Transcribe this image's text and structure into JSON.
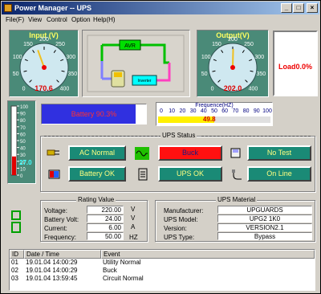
{
  "window": {
    "title": "Power Manager -- UPS"
  },
  "menu": [
    {
      "label": "File(F)"
    },
    {
      "label": "View"
    },
    {
      "label": "Control"
    },
    {
      "label": "Option"
    },
    {
      "label": "Help(H)"
    }
  ],
  "input_gauge": {
    "label": "Input (V)",
    "ticks": [
      "0",
      "50",
      "100",
      "150",
      "200",
      "250",
      "300",
      "350",
      "400"
    ],
    "value": "170.6",
    "reading": 170.6,
    "max": 400
  },
  "output_gauge": {
    "label": "Output(V)",
    "ticks": [
      "0",
      "50",
      "100",
      "150",
      "200",
      "250",
      "300",
      "350",
      "400"
    ],
    "value": "202.0",
    "reading": 202.0,
    "max": 400
  },
  "diagram": {
    "avr_label": "AVR",
    "inverter_label": "Inverter"
  },
  "load": {
    "text": "Load0.0%"
  },
  "thermometer": {
    "ticks": [
      "100",
      "90",
      "80",
      "70",
      "60",
      "50",
      "40",
      "30",
      "20",
      "10",
      "0"
    ],
    "value": "27.0",
    "level": 27
  },
  "battery": {
    "text": "Battery 90.3%",
    "level": 90.3
  },
  "frequency": {
    "label": "Frequence(HZ)",
    "ticks": [
      "0",
      "10",
      "20",
      "30",
      "40",
      "50",
      "60",
      "70",
      "80",
      "90",
      "100"
    ],
    "value": "49.8",
    "level": 49.8
  },
  "ups_status": {
    "title": "UPS Status",
    "ac_normal": "AC Normal",
    "buck": "Buck",
    "no_test": "No Test",
    "battery_ok": "Battery OK",
    "ups_ok": "UPS OK",
    "on_line": "On Line"
  },
  "rating": {
    "title": "Rating Value",
    "rows": [
      {
        "label": "Voltage:",
        "value": "220.00",
        "unit": "V"
      },
      {
        "label": "Battery Volt:",
        "value": "24.00",
        "unit": "V"
      },
      {
        "label": "Current:",
        "value": "6.00",
        "unit": "A"
      },
      {
        "label": "Frequency:",
        "value": "50.00",
        "unit": "HZ"
      }
    ]
  },
  "material": {
    "title": "UPS Material",
    "rows": [
      {
        "label": "Manufacturer:",
        "value": "UPGUARDS"
      },
      {
        "label": "UPS Model:",
        "value": "UPG2 1K0"
      },
      {
        "label": "Version:",
        "value": "VERSION2.1"
      },
      {
        "label": "UPS Type:",
        "value": "Bypass"
      }
    ]
  },
  "events": {
    "columns": [
      "ID",
      "Date / Time",
      "Event"
    ],
    "rows": [
      {
        "id": "01",
        "time": "19.01.04 14:00:29",
        "event": "Utility Normal"
      },
      {
        "id": "02",
        "time": "19.01.04 14:00:29",
        "event": "Buck"
      },
      {
        "id": "03",
        "time": "19.01.04 13:59:45",
        "event": "Circuit Normal"
      }
    ]
  },
  "colors": {
    "teal_panel": "#4a8a78",
    "status_green": "#1a8a76",
    "status_red": "#ff1010",
    "battery_bar": "#3030e0",
    "frequency_bar": "#fff000",
    "title_gradient_start": "#0a246a"
  }
}
